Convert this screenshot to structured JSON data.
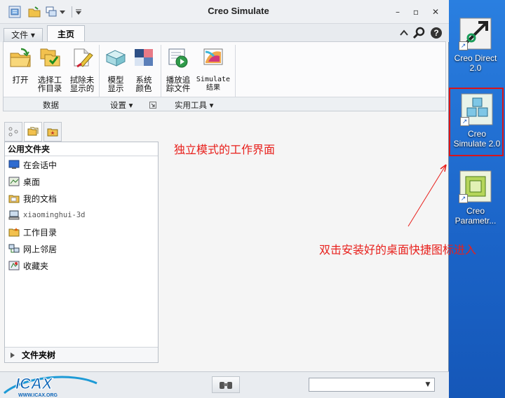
{
  "window": {
    "title": "Creo Simulate",
    "controls": [
      "–",
      "▫",
      "✕"
    ]
  },
  "ribbon": {
    "file_tab": "文件 ▾",
    "home_tab": "主页",
    "buttons": [
      {
        "label": "打开",
        "icon": "open-folder-icon"
      },
      {
        "label": "选择工\n作目录",
        "icon": "select-workdir-icon"
      },
      {
        "label": "拭除未\n显示的",
        "icon": "erase-not-displayed-icon"
      },
      {
        "label": "模型\n显示",
        "icon": "model-display-icon"
      },
      {
        "label": "系统\n颜色",
        "icon": "system-colors-icon"
      },
      {
        "label": "播放追\n踪文件",
        "icon": "play-trail-icon"
      },
      {
        "label": "Simulate\n结果",
        "icon": "simulate-results-icon"
      }
    ],
    "groups": {
      "data": "数据",
      "settings": "设置 ▾",
      "tools": "实用工具 ▾"
    }
  },
  "navigator": {
    "header": "公用文件夹",
    "items": [
      {
        "label": "在会话中",
        "icon": "in-session-icon"
      },
      {
        "label": "桌面",
        "icon": "desktop-icon"
      },
      {
        "label": "我的文档",
        "icon": "my-documents-icon"
      },
      {
        "label": "xiaominghui-3d",
        "icon": "computer-icon"
      },
      {
        "label": "工作目录",
        "icon": "working-directory-icon"
      },
      {
        "label": "网上邻居",
        "icon": "network-icon"
      },
      {
        "label": "收藏夹",
        "icon": "favorites-icon"
      }
    ],
    "folder_tree": "文件夹树"
  },
  "annotations": {
    "standalone": "独立模式的工作界面",
    "double_click": "双击安装好的桌面快捷图标进入"
  },
  "desktop": {
    "icons": [
      {
        "label": "Creo Direct 2.0"
      },
      {
        "label": "Creo Simulate 2.0"
      },
      {
        "label": "Creo Parametr..."
      }
    ]
  },
  "statusbar": {
    "logo_text": "ICAX",
    "logo_url": "WWW.ICAX.ORG"
  },
  "colors": {
    "annotation": "#e8201c",
    "desktop": "#1b64c8"
  }
}
